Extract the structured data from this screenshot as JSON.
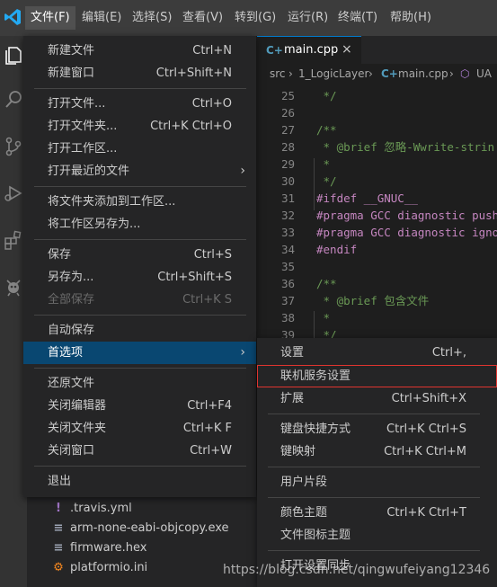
{
  "menubar": {
    "items": [
      {
        "label": "文件(F)",
        "active": true
      },
      {
        "label": "编辑(E)"
      },
      {
        "label": "选择(S)"
      },
      {
        "label": "查看(V)"
      },
      {
        "label": "转到(G)"
      },
      {
        "label": "运行(R)"
      },
      {
        "label": "终端(T)"
      },
      {
        "label": "帮助(H)"
      }
    ]
  },
  "file_menu": {
    "items": [
      {
        "label": "新建文件",
        "shortcut": "Ctrl+N"
      },
      {
        "label": "新建窗口",
        "shortcut": "Ctrl+Shift+N"
      },
      {
        "label": "打开文件...",
        "shortcut": "Ctrl+O"
      },
      {
        "label": "打开文件夹...",
        "shortcut": "Ctrl+K Ctrl+O"
      },
      {
        "label": "打开工作区..."
      },
      {
        "label": "打开最近的文件",
        "submenu_indicator": "›"
      },
      {
        "label": "将文件夹添加到工作区..."
      },
      {
        "label": "将工作区另存为..."
      },
      {
        "label": "保存",
        "shortcut": "Ctrl+S"
      },
      {
        "label": "另存为...",
        "shortcut": "Ctrl+Shift+S"
      },
      {
        "label": "全部保存",
        "shortcut": "Ctrl+K S",
        "disabled": true
      },
      {
        "label": "自动保存"
      },
      {
        "label": "首选项",
        "submenu_indicator": "›",
        "selected": true
      },
      {
        "label": "还原文件"
      },
      {
        "label": "关闭编辑器",
        "shortcut": "Ctrl+F4"
      },
      {
        "label": "关闭文件夹",
        "shortcut": "Ctrl+K F"
      },
      {
        "label": "关闭窗口",
        "shortcut": "Ctrl+W"
      },
      {
        "label": "退出"
      }
    ]
  },
  "preferences_submenu": {
    "items": [
      {
        "label": "设置",
        "shortcut": "Ctrl+,"
      },
      {
        "label": "联机服务设置",
        "highlighted": true
      },
      {
        "label": "扩展",
        "shortcut": "Ctrl+Shift+X"
      },
      {
        "label": "键盘快捷方式",
        "shortcut": "Ctrl+K Ctrl+S"
      },
      {
        "label": "键映射",
        "shortcut": "Ctrl+K Ctrl+M"
      },
      {
        "label": "用户片段"
      },
      {
        "label": "颜色主题",
        "shortcut": "Ctrl+K Ctrl+T"
      },
      {
        "label": "文件图标主题"
      },
      {
        "label": "打开设置同步"
      }
    ]
  },
  "editor": {
    "tab": {
      "label": "main.cpp",
      "icon_text": "C+",
      "close_glyph": "×"
    },
    "breadcrumb": [
      "src",
      "1_LogicLayer",
      "main.cpp",
      "UA"
    ],
    "breadcrumb_sep": "›",
    "lines": [
      {
        "num": "25",
        "text": " */",
        "cls": "c-comment"
      },
      {
        "num": "26",
        "text": "",
        "cls": "c-plain"
      },
      {
        "num": "27",
        "text": "/**",
        "cls": "c-comment"
      },
      {
        "num": "28",
        "text": " * @brief 忽略-Wwrite-strin",
        "cls": "c-comment"
      },
      {
        "num": "29",
        "text": " *",
        "cls": "c-comment"
      },
      {
        "num": "30",
        "text": " */",
        "cls": "c-comment"
      },
      {
        "num": "31",
        "text": "#ifdef __GNUC__",
        "cls": "c-pp"
      },
      {
        "num": "32",
        "text": "#pragma GCC diagnostic push",
        "cls": "c-pp"
      },
      {
        "num": "33",
        "text": "#pragma GCC diagnostic igno",
        "cls": "c-pp"
      },
      {
        "num": "34",
        "text": "#endif",
        "cls": "c-pp"
      },
      {
        "num": "35",
        "text": "",
        "cls": "c-plain"
      },
      {
        "num": "36",
        "text": "/**",
        "cls": "c-comment"
      },
      {
        "num": "37",
        "text": " * @brief 包含文件",
        "cls": "c-comment"
      },
      {
        "num": "38",
        "text": " *",
        "cls": "c-comment"
      },
      {
        "num": "39",
        "text": " */",
        "cls": "c-comment"
      }
    ]
  },
  "explorer": {
    "items": [
      {
        "label": ".travis.yml",
        "icon": "!",
        "icon_color": "#a074c4"
      },
      {
        "label": "arm-none-eabi-objcopy.exe",
        "icon": "≡",
        "icon_color": "#9da5b4"
      },
      {
        "label": "firmware.hex",
        "icon": "≡",
        "icon_color": "#9da5b4"
      },
      {
        "label": "platformio.ini",
        "icon": "⚙",
        "icon_color": "#f5871f"
      }
    ]
  },
  "watermark": "https://blog.csdn.net/qingwufeiyang12346",
  "colors": {
    "accent": "#007acc",
    "selection": "#094771",
    "highlight_box": "#e0342f"
  }
}
